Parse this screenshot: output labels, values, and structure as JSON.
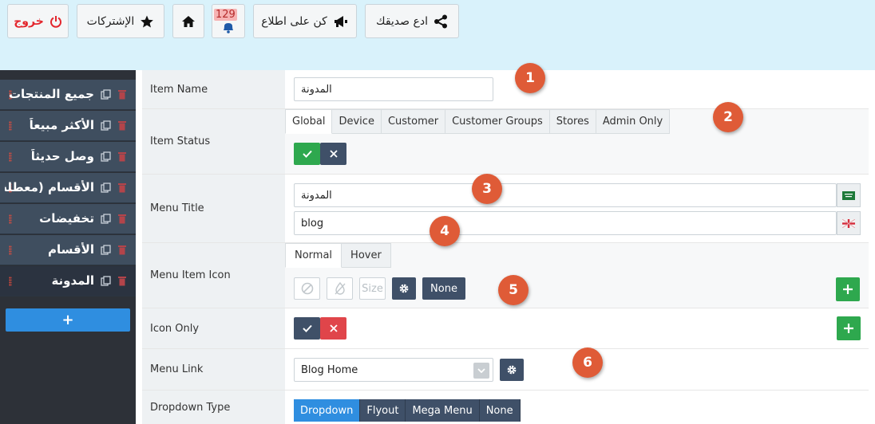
{
  "topbar": {
    "logout_label": "خروج",
    "subscriptions_label": "الإشتركات",
    "notifications_count": "129",
    "stay_informed_label": "كن على اطلاع",
    "invite_friend_label": "ادع صديقك"
  },
  "sidebar": {
    "items": [
      {
        "label": "جميع المنتجات"
      },
      {
        "label": "الأكثر مبيعاً"
      },
      {
        "label": "وصل حديثاً"
      },
      {
        "label": "الأقسام (معطلة)"
      },
      {
        "label": "تخفيضات"
      },
      {
        "label": "الأقسام"
      },
      {
        "label": "المدونة"
      }
    ],
    "add_label": "+"
  },
  "form": {
    "item_name": {
      "label": "Item Name",
      "value": "المدونة"
    },
    "item_status": {
      "label": "Item Status",
      "tabs": [
        "Global",
        "Device",
        "Customer",
        "Customer Groups",
        "Stores",
        "Admin Only"
      ]
    },
    "menu_title": {
      "label": "Menu Title",
      "value_ar": "المدونة",
      "value_en": "blog"
    },
    "menu_item_icon": {
      "label": "Menu Item Icon",
      "tabs": [
        "Normal",
        "Hover"
      ],
      "size_placeholder": "Size",
      "none_label": "None"
    },
    "icon_only": {
      "label": "Icon Only"
    },
    "menu_link": {
      "label": "Menu Link",
      "value": "Blog Home"
    },
    "dropdown_type": {
      "label": "Dropdown Type",
      "options": [
        "Dropdown",
        "Flyout",
        "Mega Menu",
        "None"
      ],
      "selected": "Dropdown"
    }
  },
  "markers": [
    "1",
    "2",
    "3",
    "4",
    "5",
    "6"
  ],
  "colors": {
    "topbar_bg": "#d9f2fb",
    "sidebar_bg": "#3f4e5f",
    "accent_blue": "#2f8ee0",
    "success_green": "#2ea84e",
    "danger_red": "#e0454a",
    "marker_orange": "#df5b37"
  }
}
